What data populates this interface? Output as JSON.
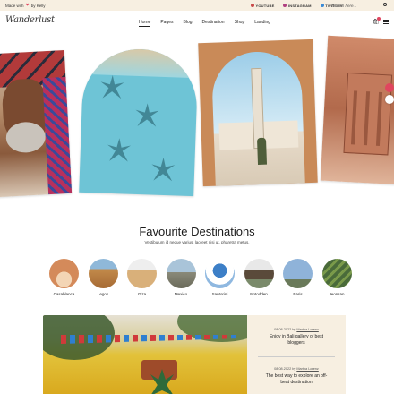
{
  "topbar": {
    "made_text_1": "Made with",
    "heart": "❤",
    "made_text_2": "by Kelly",
    "social": [
      "YOUTUBE",
      "INSTAGRAM",
      "TWITTER"
    ],
    "search_placeholder": "Search here..."
  },
  "header": {
    "logo": "Wanderlust",
    "menu": [
      "Home",
      "Pages",
      "Blog",
      "Destination",
      "Shop",
      "Landing"
    ],
    "active_menu": "Home",
    "cart_icon": "bag-icon",
    "menu_icon": "hamburger-icon"
  },
  "section": {
    "title": "Favourite Destinations",
    "subtitle": "Vestibulum id neque varius, laoreet nisi ut, pharetra metus."
  },
  "destinations": [
    {
      "name": "Casablanca",
      "color": "#d48a5a"
    },
    {
      "name": "Legos",
      "color": "#c28a4a"
    },
    {
      "name": "Giza",
      "color": "#d9b07a"
    },
    {
      "name": "Mexico",
      "color": "#a9c4d9"
    },
    {
      "name": "Santorini",
      "color": "#3d7fc7"
    },
    {
      "name": "Notodden",
      "color": "#7a8a6a"
    },
    {
      "name": "Paris",
      "color": "#8fb3d9"
    },
    {
      "name": "Jeonsan",
      "color": "#4a6b3a"
    }
  ],
  "posts": [
    {
      "date": "08.08.2022",
      "by": "by",
      "author": "Martha Lorenz",
      "title_lines": [
        "Enjoy in Bali gallery of best",
        "bloggers"
      ]
    },
    {
      "date": "08.08.2022",
      "by": "by",
      "author": "Martha Lorenz",
      "title_lines": [
        "The best way to explore an off-",
        "beat destination"
      ]
    }
  ],
  "colors": {
    "accent": "#e0465f",
    "cream": "#f7efe1"
  }
}
